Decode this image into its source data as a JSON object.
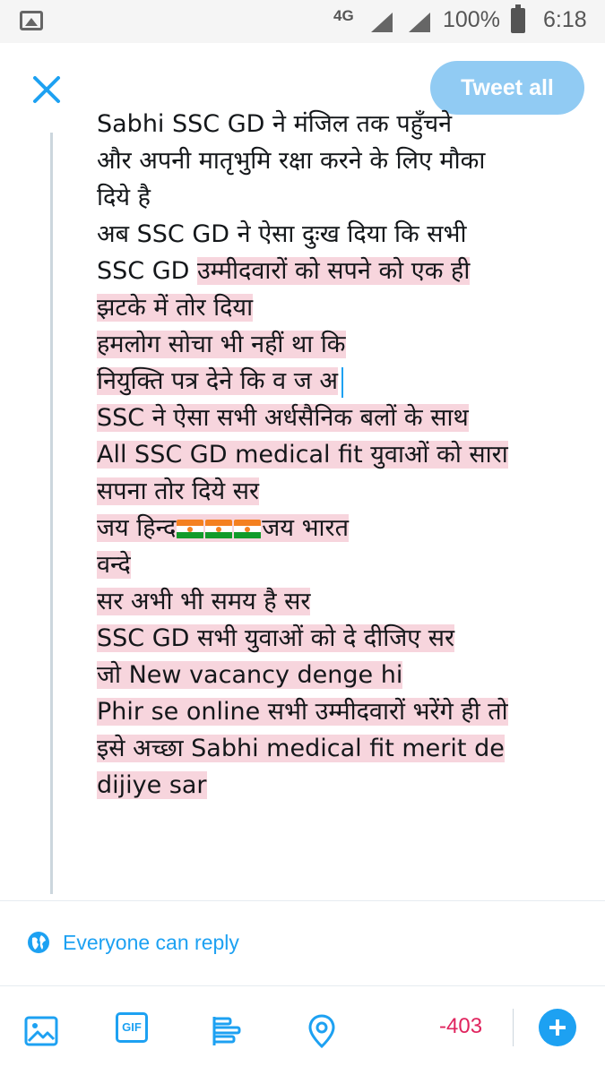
{
  "status_bar": {
    "network": "4G",
    "battery": "100%",
    "time": "6:18"
  },
  "header": {
    "tweet_all_label": "Tweet all"
  },
  "compose": {
    "lines": [
      "Sabhi SSC GD ने मंजिल तक पहुँचने",
      "और अपनी मातृभुमि रक्षा करने के लिए मौका",
      "दिये है",
      "अब SSC GD ने ऐसा दुःख दिया कि सभी",
      "SSC GD ",
      "उम्मीदवारों को सपने को एक ही",
      "झटके में तोर दिया",
      "हमलोग सोचा भी नहीं था कि",
      "नियुक्ति पत्र देने कि व ज अ",
      "SSC ने ऐसा  सभी अर्धसैनिक बलों के साथ",
      "All SSC GD medical fit युवाओं को सारा",
      "सपना तोर दिये सर",
      "जय हिन्द",
      "जय भारत",
      "वन्दे",
      "सर अभी भी समय है सर",
      "SSC GD सभी युवाओं को दे दीजिए सर",
      "जो New vacancy denge hi",
      "Phir se online सभी उम्मीदवारों भरेंगे ही तो",
      "इसे अच्छा  Sabhi medical fit  merit de",
      "dijiye sar"
    ]
  },
  "reply": {
    "label": "Everyone can reply"
  },
  "toolbar": {
    "gif_label": "GIF",
    "char_count": "-403"
  },
  "colors": {
    "accent": "#1da1f2",
    "tweet_button_disabled": "#91cbf3",
    "highlight": "#f7d5dd",
    "over_limit": "#e0245e"
  }
}
